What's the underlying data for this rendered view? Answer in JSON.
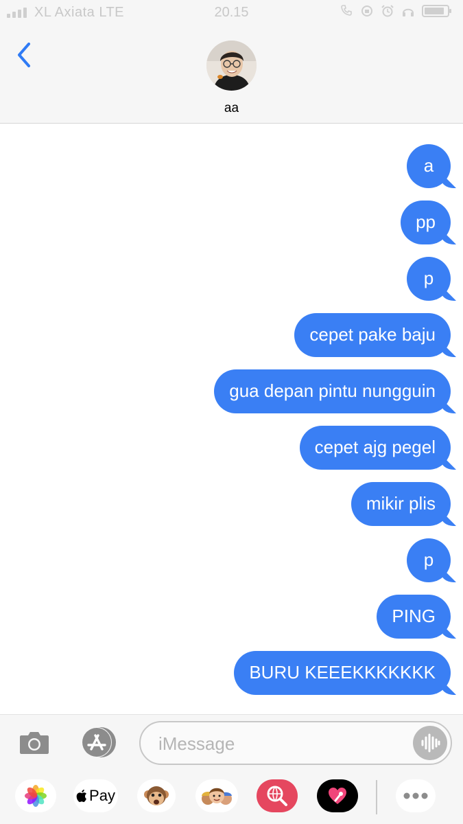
{
  "status_bar": {
    "carrier": "XL Axiata  LTE",
    "time": "20.15",
    "battery_level": 0.88
  },
  "header": {
    "contact_name": "aa"
  },
  "messages": [
    {
      "text": "a",
      "sender": "me"
    },
    {
      "text": "pp",
      "sender": "me"
    },
    {
      "text": "p",
      "sender": "me"
    },
    {
      "text": "cepet pake baju",
      "sender": "me"
    },
    {
      "text": "gua depan pintu nungguin",
      "sender": "me"
    },
    {
      "text": "cepet ajg pegel",
      "sender": "me"
    },
    {
      "text": "mikir plis",
      "sender": "me"
    },
    {
      "text": "p",
      "sender": "me"
    },
    {
      "text": "PING",
      "sender": "me"
    },
    {
      "text": "BURU KEEEKKKKKKK",
      "sender": "me"
    }
  ],
  "composer": {
    "placeholder": "iMessage"
  },
  "app_drawer": {
    "apple_pay_label": "Pay",
    "apps": [
      "photos-icon",
      "apple-pay-icon",
      "animoji-icon",
      "memoji-icon",
      "web-search-icon",
      "digital-touch-icon",
      "more-icon"
    ]
  },
  "colors": {
    "bubble": "#3a7ff4",
    "accent": "#2f7bf5",
    "header_bg": "#f6f6f6"
  }
}
